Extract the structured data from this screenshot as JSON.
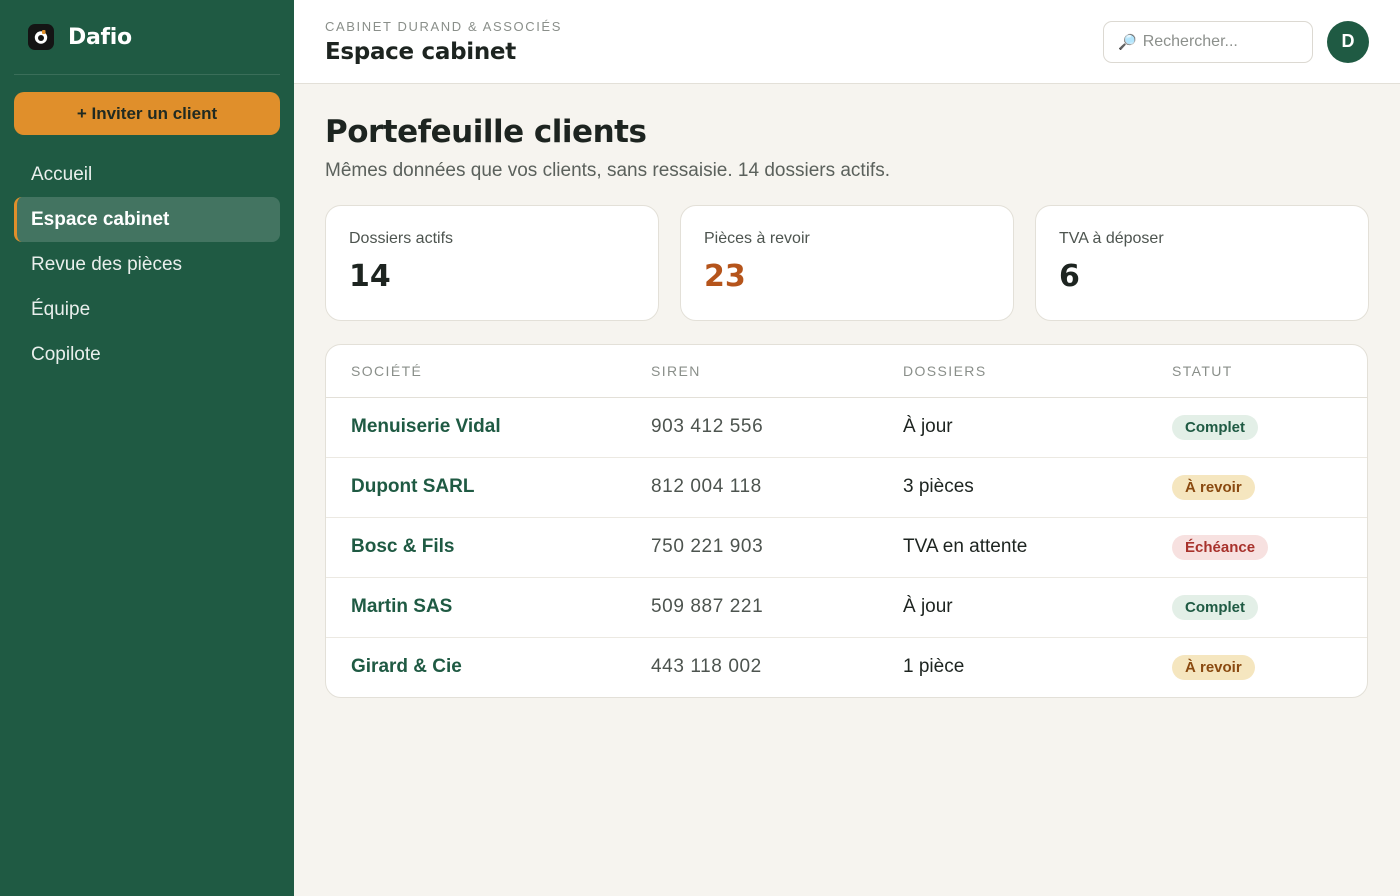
{
  "app": {
    "name": "Dafio"
  },
  "sidebar": {
    "invite_label": "+ Inviter un client",
    "items": [
      {
        "label": "Accueil",
        "active": false
      },
      {
        "label": "Espace cabinet",
        "active": true
      },
      {
        "label": "Revue des pièces",
        "active": false
      },
      {
        "label": "Équipe",
        "active": false
      },
      {
        "label": "Copilote",
        "active": false
      }
    ]
  },
  "header": {
    "firm": "CABINET DURAND & ASSOCIÉS",
    "title": "Espace cabinet",
    "search_placeholder": "Rechercher...",
    "avatar_initial": "D"
  },
  "page": {
    "title": "Portefeuille clients",
    "subtitle": "Mêmes données que vos clients, sans ressaisie. 14 dossiers actifs."
  },
  "stats": [
    {
      "label": "Dossiers actifs",
      "value": "14"
    },
    {
      "label": "Pièces à revoir",
      "value": "23"
    },
    {
      "label": "TVA à déposer",
      "value": "6"
    }
  ],
  "table": {
    "headers": [
      "SOCIÉTÉ",
      "SIREN",
      "DOSSIERS",
      "STATUT"
    ],
    "rows": [
      {
        "company": "Menuiserie Vidal",
        "siren": "903 412 556",
        "dossiers": "À jour",
        "status": "Complet"
      },
      {
        "company": "Dupont SARL",
        "siren": "812 004 118",
        "dossiers": "3 pièces",
        "status": "À revoir"
      },
      {
        "company": "Bosc & Fils",
        "siren": "750 221 903",
        "dossiers": "TVA en attente",
        "status": "Échéance"
      },
      {
        "company": "Martin SAS",
        "siren": "509 887 221",
        "dossiers": "À jour",
        "status": "Complet"
      },
      {
        "company": "Girard & Cie",
        "siren": "443 118 002",
        "dossiers": "1 pièce",
        "status": "À revoir"
      }
    ]
  },
  "colors": {
    "sidebar": "#1f5a43",
    "accent": "#e08f2b",
    "warn": "#b5541b"
  }
}
